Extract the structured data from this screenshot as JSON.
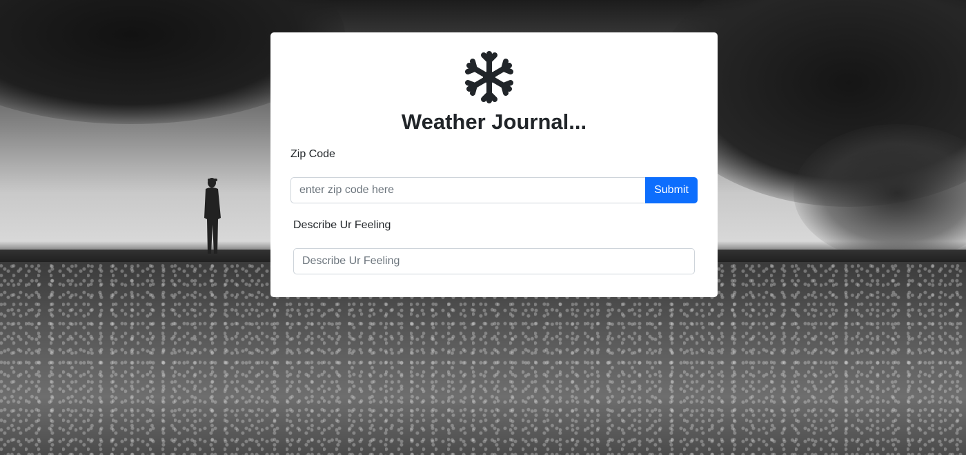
{
  "app": {
    "title": "Weather Journal...",
    "logo_icon": "snowflake-icon"
  },
  "form": {
    "zip": {
      "label": "Zip Code",
      "placeholder": "enter zip code here",
      "value": ""
    },
    "submit_label": "Submit",
    "feeling": {
      "label": "Describe Ur Feeling",
      "placeholder": "Describe Ur Feeling",
      "value": ""
    }
  },
  "colors": {
    "accent": "#0d6efd",
    "text": "#212529",
    "card_bg": "#ffffff"
  }
}
